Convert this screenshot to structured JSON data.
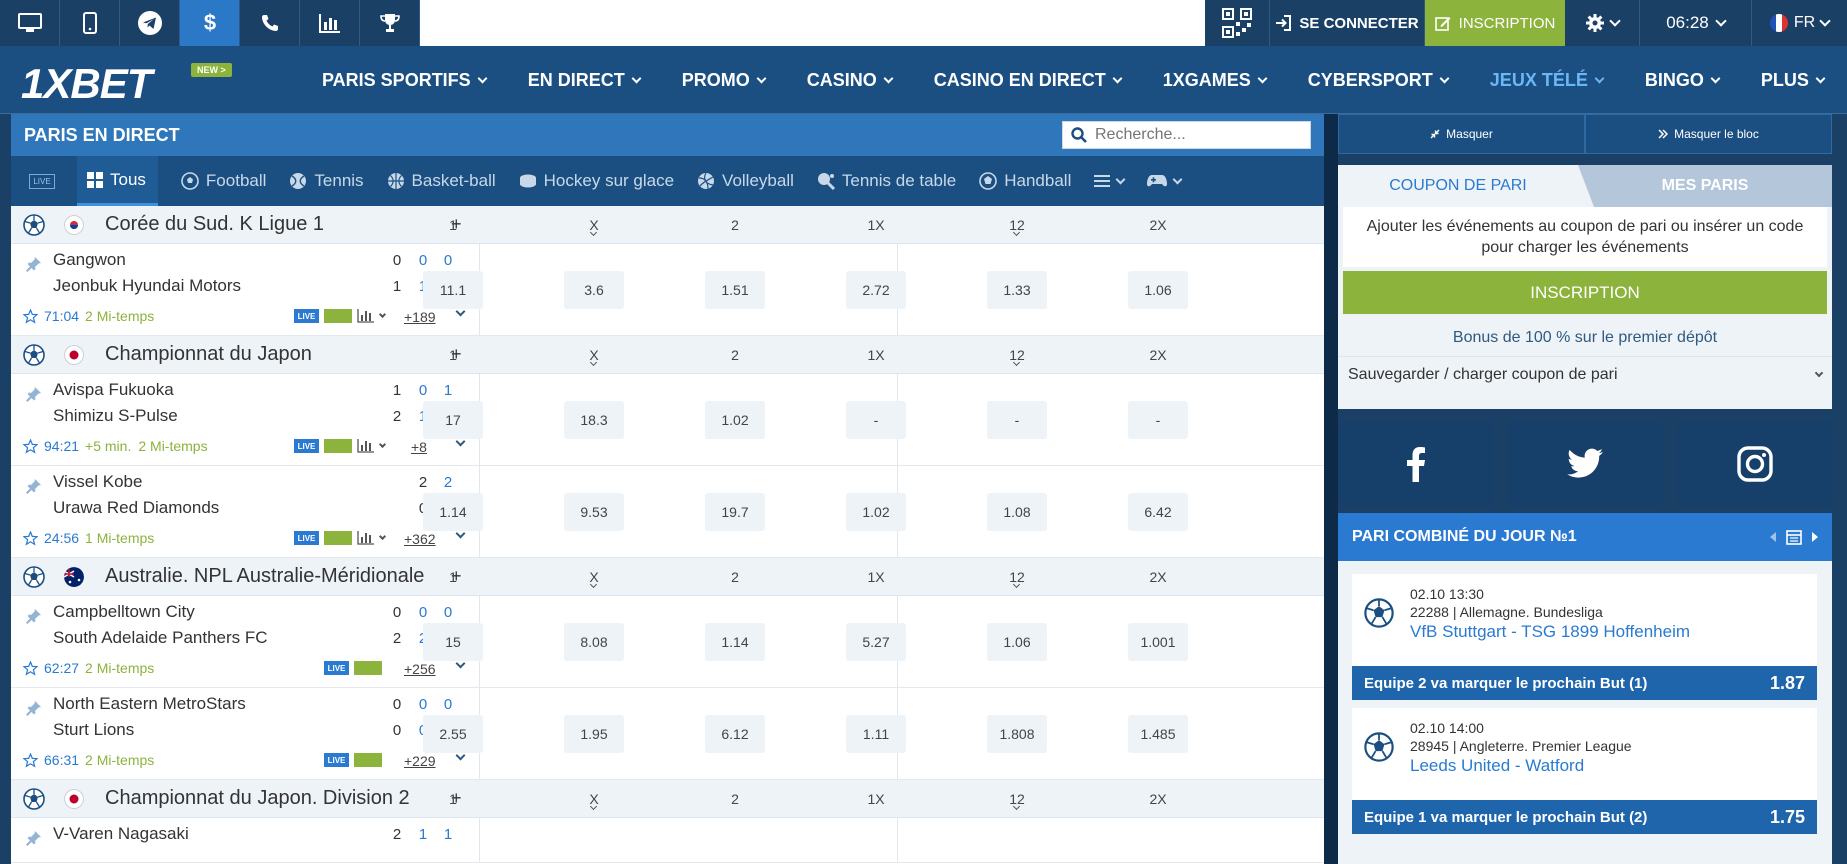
{
  "topbar": {
    "login_label": "SE CONNECTER",
    "register_label": "INSCRIPTION",
    "time": "06:28",
    "lang": "FR"
  },
  "nav": {
    "logo": "1XBET",
    "new_badge": "NEW >",
    "items": [
      "PARIS SPORTIFS",
      "EN DIRECT",
      "PROMO",
      "CASINO",
      "CASINO EN DIRECT",
      "1XGAMES",
      "CYBERSPORT",
      "JEUX TÉLÉ",
      "BINGO",
      "PLUS"
    ]
  },
  "live": {
    "title": "PARIS EN DIRECT",
    "search_placeholder": "Recherche...",
    "live_badge": "LIVE",
    "tabs": [
      "Tous",
      "Football",
      "Tennis",
      "Basket-ball",
      "Hockey sur glace",
      "Volleyball",
      "Tennis de table",
      "Handball"
    ],
    "odds_headers": [
      "1",
      "X",
      "2",
      "1X",
      "12",
      "2X"
    ],
    "championships": [
      {
        "name": "Corée du Sud. K Ligue 1",
        "matches": [
          {
            "team1": "Gangwon",
            "team2": "Jeonbuk Hyundai Motors",
            "scores1": [
              "0",
              "0",
              "0"
            ],
            "scores2": [
              "1",
              "1",
              "0"
            ],
            "time": "71:04",
            "extra": "",
            "period": "2 Mi-temps",
            "more": "+189",
            "odds": [
              "11.1",
              "3.6",
              "1.51",
              "2.72",
              "1.33",
              "1.06"
            ]
          }
        ]
      },
      {
        "name": "Championnat du Japon",
        "matches": [
          {
            "team1": "Avispa Fukuoka",
            "team2": "Shimizu S-Pulse",
            "scores1": [
              "1",
              "0",
              "1"
            ],
            "scores2": [
              "2",
              "1",
              "1"
            ],
            "time": "94:21",
            "extra": "+5 min.",
            "period": "2 Mi-temps",
            "more": "+8",
            "odds": [
              "17",
              "18.3",
              "1.02",
              "-",
              "-",
              "-"
            ]
          },
          {
            "team1": "Vissel Kobe",
            "team2": "Urawa Red Diamonds",
            "scores1": [
              "2",
              "2"
            ],
            "scores2": [
              "0",
              "0"
            ],
            "time": "24:56",
            "extra": "",
            "period": "1 Mi-temps",
            "more": "+362",
            "odds": [
              "1.14",
              "9.53",
              "19.7",
              "1.02",
              "1.08",
              "6.42"
            ]
          }
        ]
      },
      {
        "name": "Australie. NPL Australie-Méridionale",
        "matches": [
          {
            "team1": "Campbelltown City",
            "team2": "South Adelaide Panthers FC",
            "scores1": [
              "0",
              "0",
              "0"
            ],
            "scores2": [
              "2",
              "2",
              "0"
            ],
            "time": "62:27",
            "extra": "",
            "period": "2 Mi-temps",
            "more": "+256",
            "odds": [
              "15",
              "8.08",
              "1.14",
              "5.27",
              "1.06",
              "1.001"
            ]
          },
          {
            "team1": "North Eastern MetroStars",
            "team2": "Sturt Lions",
            "scores1": [
              "0",
              "0",
              "0"
            ],
            "scores2": [
              "0",
              "0",
              "0"
            ],
            "time": "66:31",
            "extra": "",
            "period": "2 Mi-temps",
            "more": "+229",
            "odds": [
              "2.55",
              "1.95",
              "6.12",
              "1.11",
              "1.808",
              "1.485"
            ]
          }
        ]
      },
      {
        "name": "Championnat du Japon. Division 2",
        "matches": [
          {
            "team1": "V-Varen Nagasaki",
            "team2": "",
            "scores1": [
              "2",
              "1",
              "1"
            ],
            "scores2": [],
            "time": "",
            "extra": "",
            "period": "",
            "more": "",
            "odds": []
          }
        ]
      }
    ]
  },
  "right": {
    "hide_label": "Masquer",
    "hide_block_label": "Masquer le bloc",
    "coupon_tab": "COUPON DE PARI",
    "mybets_tab": "MES PARIS",
    "coupon_msg": "Ajouter les événements au coupon de pari ou insérer un code pour charger les événements",
    "register_btn": "INSCRIPTION",
    "bonus": "Bonus de 100 % sur le premier dépôt",
    "save_label": "Sauvegarder / charger coupon de pari",
    "combo_title": "PARI COMBINÉ DU JOUR №1",
    "events": [
      {
        "date": "02.10  13:30",
        "league": "22288 | Allemagne. Bundesliga",
        "teams": "VfB Stuttgart - TSG 1899 Hoffenheim",
        "bet": "Equipe 2 va marquer le prochain But (1)",
        "odd": "1.87"
      },
      {
        "date": "02.10  14:00",
        "league": "28945 | Angleterre. Premier League",
        "teams": "Leeds United - Watford",
        "bet": "Equipe 1 va marquer le prochain But (2)",
        "odd": "1.75"
      }
    ]
  },
  "colors": {
    "brand": "#1b4f82",
    "accent": "#2a7ad1",
    "green": "#8cb33c"
  }
}
